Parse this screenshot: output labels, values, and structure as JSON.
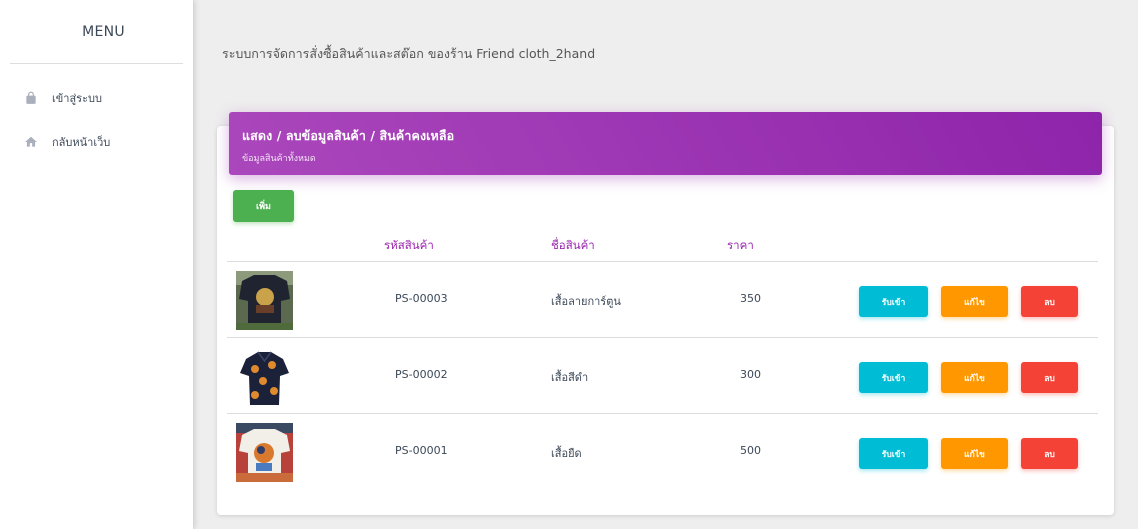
{
  "sidebar": {
    "title": "MENU",
    "items": [
      {
        "label": "เข้าสู่ระบบ",
        "icon": "lock-icon"
      },
      {
        "label": "กลับหน้าเว็บ",
        "icon": "home-icon"
      }
    ]
  },
  "header": {
    "title": "ระบบการจัดการสั่งซื้อสินค้าและสต๊อก ของร้าน Friend cloth_2hand"
  },
  "card": {
    "title": "แสดง / ลบข้อมูลสินค้า / สินค้าคงเหลือ",
    "subtitle": "ข้อมูลสินค้าทั้งหมด",
    "add_label": "เพิ่ม"
  },
  "table": {
    "columns": [
      "รหัสสินค้า",
      "ชื่อสินค้า",
      "ราคา"
    ],
    "rows": [
      {
        "code": "PS-00003",
        "name": "เสื้อลายการ์ตูน",
        "price": "350",
        "image": "dark-printed-tshirt-image"
      },
      {
        "code": "PS-00002",
        "name": "เสื้อสีดำ",
        "price": "300",
        "image": "dark-patterned-shirt-image"
      },
      {
        "code": "PS-00001",
        "name": "เสื้อยืด",
        "price": "500",
        "image": "white-printed-tshirt-image"
      }
    ],
    "actions": {
      "receive": "รับเข้า",
      "edit": "แก้ไข",
      "delete": "ลบ"
    }
  },
  "colors": {
    "header_gradient_start": "#ab47bc",
    "header_gradient_end": "#8e24aa",
    "add": "#4caf50",
    "receive": "#00bcd4",
    "edit": "#ff9800",
    "delete": "#f44336",
    "column_header": "#9c27b0"
  }
}
